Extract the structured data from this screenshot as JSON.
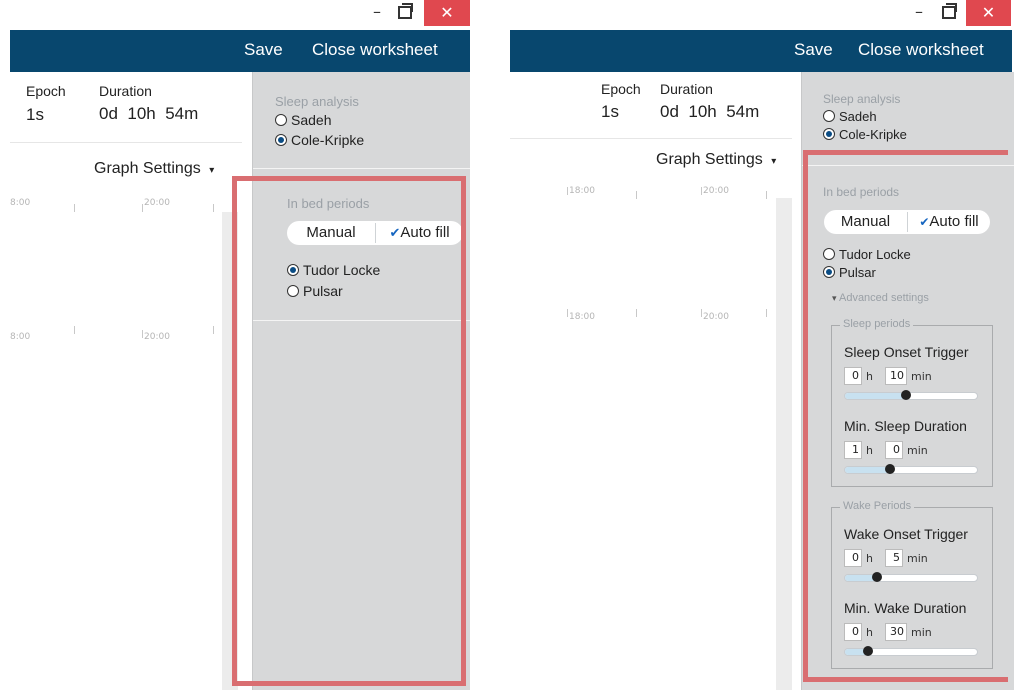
{
  "window": {
    "close_glyph": "✕",
    "minimize_glyph": "–"
  },
  "appbar": {
    "save_label": "Save",
    "close_worksheet_label": "Close worksheet",
    "background": "#08476e"
  },
  "summary": {
    "epoch_label": "Epoch",
    "epoch_value": "1s",
    "duration_label": "Duration",
    "duration_days": "0d",
    "duration_hours": "10h",
    "duration_minutes": "54m"
  },
  "graph_settings": {
    "label": "Graph Settings",
    "caret": "▾"
  },
  "axis": {
    "left_row1": [
      "8:00",
      "20:00"
    ],
    "left_row2": [
      "8:00",
      "20:00"
    ],
    "right_row1": [
      "18:00",
      "20:00"
    ],
    "right_row2": [
      "18:00",
      "20:00"
    ]
  },
  "sleep_analysis": {
    "label": "Sleep analysis",
    "options": [
      "Sadeh",
      "Cole-Kripke"
    ],
    "selected": "Cole-Kripke"
  },
  "in_bed_periods": {
    "label": "In bed periods",
    "toggle": {
      "manual_label": "Manual",
      "auto_label": "Auto fill",
      "check_glyph": "✔"
    },
    "left_selected": "Tudor Locke",
    "right_selected": "Pulsar",
    "options": [
      "Tudor Locke",
      "Pulsar"
    ]
  },
  "advanced": {
    "label": "Advanced settings",
    "caret": "▾",
    "sleep_group": "Sleep periods",
    "wake_group": "Wake Periods",
    "sleep_onset": {
      "title": "Sleep Onset Trigger",
      "hours": "0",
      "minutes": "10",
      "fraction": 0.47
    },
    "min_sleep": {
      "title": "Min. Sleep Duration",
      "hours": "1",
      "minutes": "0",
      "fraction": 0.35
    },
    "wake_onset": {
      "title": "Wake Onset Trigger",
      "hours": "0",
      "minutes": "5",
      "fraction": 0.25
    },
    "min_wake": {
      "title": "Min. Wake Duration",
      "hours": "0",
      "minutes": "30",
      "fraction": 0.18
    },
    "unit_h": "h",
    "unit_min": "min"
  },
  "colors": {
    "highlight": "#d96e71",
    "sidebar": "#d7d8d9",
    "close_button": "#e0484f"
  }
}
